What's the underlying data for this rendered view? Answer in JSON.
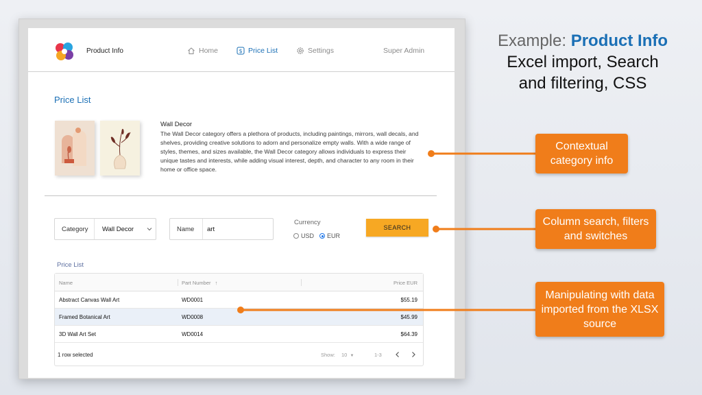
{
  "app": {
    "title": "Product Info",
    "nav": [
      {
        "label": "Home",
        "icon": "home-icon"
      },
      {
        "label": "Price List",
        "icon": "dollar-icon"
      },
      {
        "label": "Settings",
        "icon": "gear-icon"
      }
    ],
    "user": "Super Admin"
  },
  "page": {
    "title": "Price List",
    "category_name": "Wall Decor",
    "category_description": "The Wall Decor category offers a plethora of products, including paintings, mirrors, wall decals, and shelves, providing creative solutions to adorn and personalize empty walls. With a wide range of styles, themes, and sizes available, the Wall Decor category allows individuals to express their unique tastes and interests, while adding visual interest, depth, and character to any room in their home or office space."
  },
  "filters": {
    "category_label": "Category",
    "category_value": "Wall Decor",
    "name_label": "Name",
    "name_value": "art",
    "currency_label": "Currency",
    "currency_options": [
      "USD",
      "EUR"
    ],
    "currency_selected": "EUR",
    "search_label": "SEARCH"
  },
  "grid": {
    "title": "Price List",
    "columns": [
      "Name",
      "Part Number",
      "Price EUR"
    ],
    "sort_indicator": "↑",
    "rows": [
      {
        "name": "Abstract Canvas Wall Art",
        "part": "WD0001",
        "price": "$55.19"
      },
      {
        "name": "Framed Botanical Art",
        "part": "WD0008",
        "price": "$45.99"
      },
      {
        "name": "3D Wall Art Set",
        "part": "WD0014",
        "price": "$64.39"
      }
    ],
    "footer": {
      "selected": "1 row selected",
      "show_label": "Show:",
      "page_size": "10",
      "range": "1-3"
    }
  },
  "annotations": {
    "title_prefix": "Example: ",
    "title_highlight": "Product Info",
    "title_line2": "Excel import, Search",
    "title_line3": "and filtering, CSS",
    "callout_1": "Contextual category info",
    "callout_2": "Column search, filters and switches",
    "callout_3": "Manipulating with data imported from the XLSX source"
  },
  "colors": {
    "accent_blue": "#1a6fb5",
    "button_orange": "#f7a823",
    "callout_orange": "#f07d1a",
    "selected_row": "#eaf0f8"
  }
}
